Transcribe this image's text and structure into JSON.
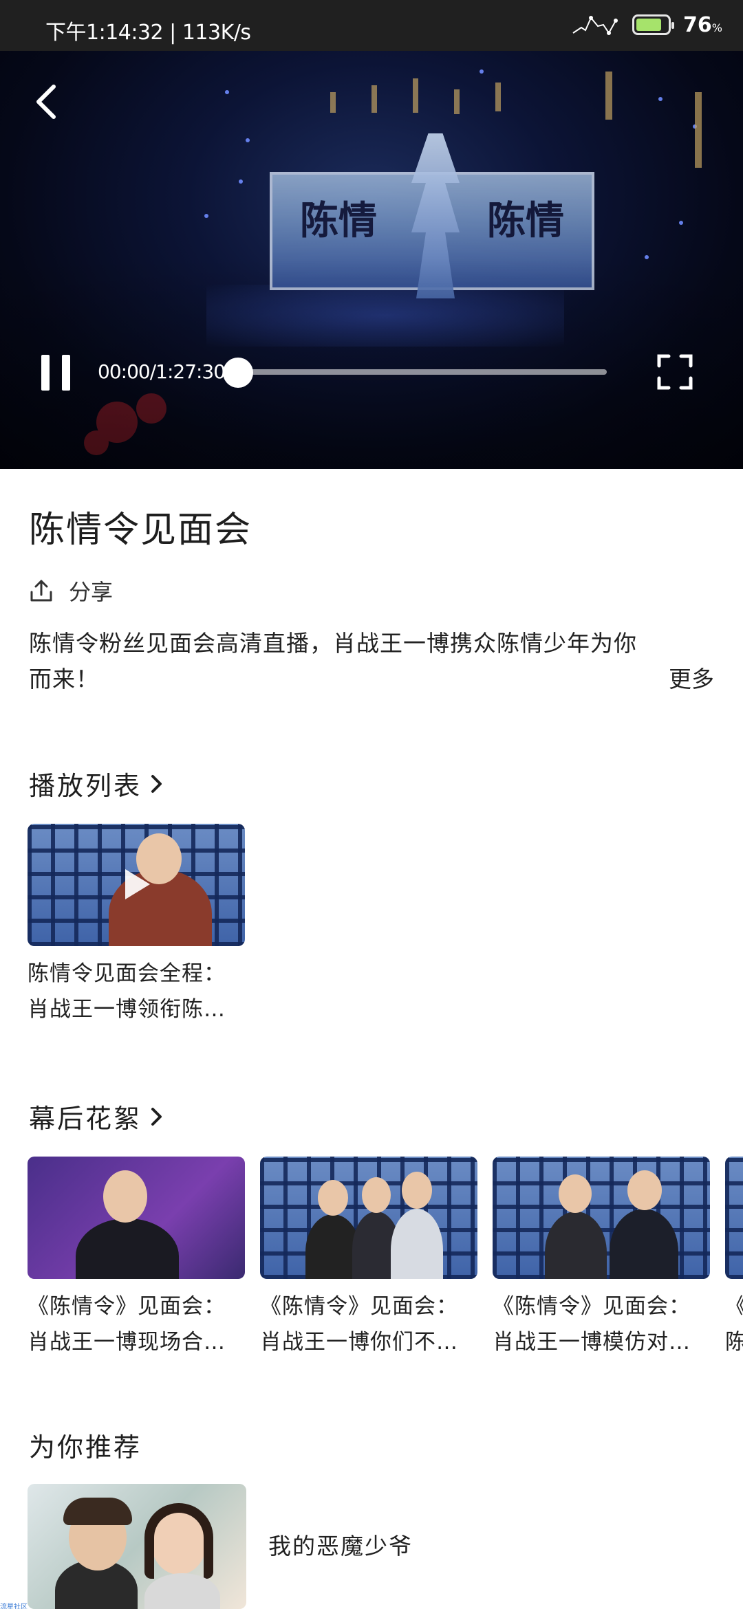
{
  "status_bar": {
    "time": "下午1:14:32 | 113K/s",
    "battery": "76",
    "battery_unit": "%",
    "battery_level": 0.76
  },
  "player": {
    "elapsed": "00:00",
    "duration": "1:27:30",
    "time_display": "00:00/1:27:30",
    "progress": 0.0,
    "stage_text_left": "陈情",
    "stage_text_right": "陈情"
  },
  "video_info": {
    "title": "陈情令见面会",
    "share_label": "分享",
    "description": "陈情令粉丝见面会高清直播，肖战王一博携众陈情少年为你而来！",
    "more_label": "更多"
  },
  "playlist": {
    "title": "播放列表",
    "items": [
      {
        "line1": "陈情令见面会全程：",
        "line2": "肖战王一博领衔陈…"
      }
    ]
  },
  "behind_scenes": {
    "title": "幕后花絮",
    "items": [
      {
        "line1": "《陈情令》见面会：",
        "line2": "肖战王一博现场合…"
      },
      {
        "line1": "《陈情令》见面会：",
        "line2": "肖战王一博你们不…"
      },
      {
        "line1": "《陈情令》见面会：",
        "line2": "肖战王一博模仿对…"
      },
      {
        "line1": "《",
        "line2": "陈"
      }
    ]
  },
  "recommend": {
    "title": "为你推荐",
    "items": [
      {
        "title": "我的恶魔少爷"
      }
    ]
  },
  "watermark": "流星社区",
  "colors": {
    "status_bar": "#202020",
    "video_bg": "#050818",
    "accent_blue": "#3b5aa0"
  }
}
